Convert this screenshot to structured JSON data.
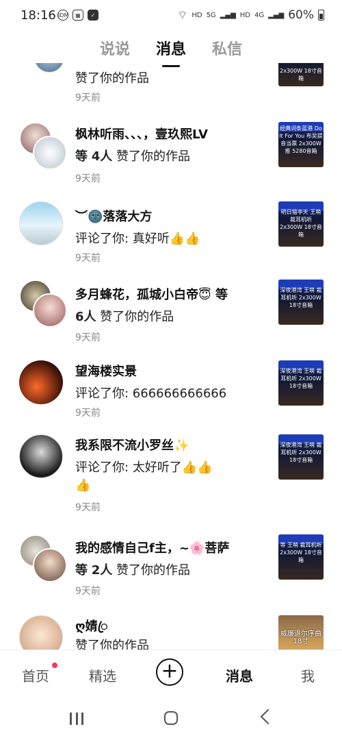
{
  "status": {
    "time": "18:16",
    "hd1": "HD",
    "sig1": "5G",
    "hd2": "HD",
    "sig2": "4G",
    "battery": "60%"
  },
  "tabs": {
    "shuoshuo": "说说",
    "messages": "消息",
    "private": "私信"
  },
  "items": [
    {
      "name": "",
      "text": "赞了你的作品",
      "time": "9天前",
      "thumb": "2x300W\n18寸音箱"
    },
    {
      "name": "枫林听雨、、、，壹玖熙LV",
      "count_prefix": "等",
      "count": "4人",
      "text": "赞了你的作品",
      "time": "9天前",
      "thumb": "经典词条蓝港 Do It For You 布吴提音当票 2x300W推 5280音箱"
    },
    {
      "name": "︶🌚落落大方",
      "text": "评论了你: 真好听👍👍",
      "time": "9天前",
      "thumb": "明日猫亭天 王萌 裁耳机听 2x300W 18寸音箱"
    },
    {
      "name": "多月蜂花，孤城小白帝😇 等",
      "count": "6人",
      "text": "赞了你的作品",
      "time": "9天前",
      "thumb": "深夜港湾 王萌 裁耳机听 2x300W 18寸音箱"
    },
    {
      "name": "望海楼实景",
      "text": "评论了你: 666666666666",
      "time": "9天前",
      "thumb": "深夜港湾 王萌 裁耳机听 2x300W 18寸音箱"
    },
    {
      "name": "我系限不流小罗丝✨",
      "text": "评论了你: 太好听了👍👍",
      "text2": "👍",
      "time": "9天前",
      "thumb": "深夜港湾 王萌 裁耳机听 2x300W 18寸音箱"
    },
    {
      "name": "我的感情自己f主，~🌸菩萨",
      "count_prefix": "等",
      "count": "2人",
      "text": "赞了你的作品",
      "time": "9天前",
      "thumb": "等 王萌 裁耳机听 2x300W 18寸音箱"
    },
    {
      "name": "ღ婧ꦿ",
      "text": "赞了你的作品",
      "thumb": "威廉退尔序曲18寸"
    }
  ],
  "nav": {
    "home": "首页",
    "select": "精选",
    "plus": "+",
    "messages": "消息",
    "me": "我"
  }
}
